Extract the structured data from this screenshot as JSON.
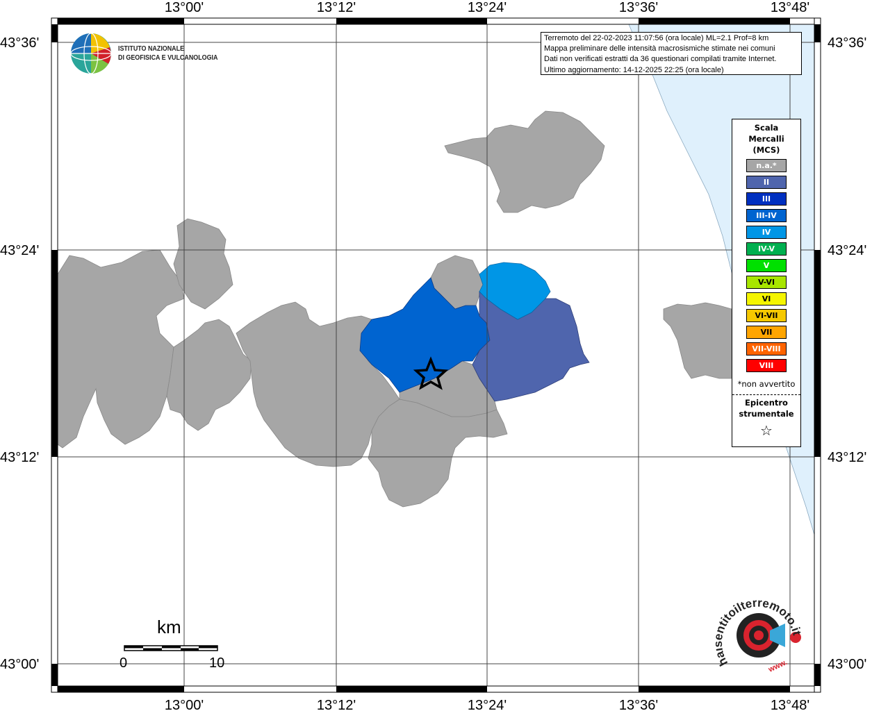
{
  "map": {
    "top_ticks": [
      "13°00'",
      "13°12'",
      "13°24'",
      "13°36'",
      "13°48'"
    ],
    "bottom_ticks": [
      "13°00'",
      "13°12'",
      "13°24'",
      "13°36'",
      "13°48'"
    ],
    "left_ticks": [
      "43°36'",
      "43°24'",
      "43°12'",
      "43°00'"
    ],
    "right_ticks": [
      "43°36'",
      "43°24'",
      "43°12'",
      "43°00'"
    ],
    "sea_color": "#dff0fc",
    "land_color": "#ffffff",
    "na_color": "#a6a6a6"
  },
  "logo": {
    "line1": "ISTITUTO NAZIONALE",
    "line2": "DI GEOFISICA E VULCANOLOGIA",
    "icon": "ingv-globe-icon"
  },
  "info": {
    "line1": "Terremoto del 22-02-2023 11:07:56 (ora locale) ML=2.1 Prof=8 km",
    "line2": "Mappa preliminare delle intensità macrosismiche stimate nei comuni",
    "line3": "Dati non verificati estratti da 36 questionari compilati tramite Internet.",
    "line4": "Ultimo aggiornamento: 14-12-2025 22:25 (ora locale)"
  },
  "legend": {
    "title1": "Scala",
    "title2": "Mercalli",
    "title3": "(MCS)",
    "items": [
      {
        "label": "n.a.*",
        "color": "#a6a6a6"
      },
      {
        "label": "II",
        "color": "#4f65ad"
      },
      {
        "label": "III",
        "color": "#0030c0"
      },
      {
        "label": "III-IV",
        "color": "#0064d0"
      },
      {
        "label": "IV",
        "color": "#0096e6"
      },
      {
        "label": "IV-V",
        "color": "#00b050"
      },
      {
        "label": "V",
        "color": "#00e000"
      },
      {
        "label": "V-VI",
        "color": "#a8e600"
      },
      {
        "label": "VI",
        "color": "#f5f500"
      },
      {
        "label": "VI-VII",
        "color": "#f5c800"
      },
      {
        "label": "VII",
        "color": "#ffa500"
      },
      {
        "label": "VII-VIII",
        "color": "#ff6400"
      },
      {
        "label": "VIII",
        "color": "#ff0000"
      }
    ],
    "note": "*non avvertito",
    "epicenter1": "Epicentro",
    "epicenter2": "strumentale",
    "star": "☆"
  },
  "scale_bar": {
    "unit": "km",
    "tick0": "0",
    "tick1": "10"
  },
  "hai_logo": {
    "text": "haisentitoilterremoto.it",
    "prefix": "www.",
    "icon": "megaphone-icon"
  }
}
